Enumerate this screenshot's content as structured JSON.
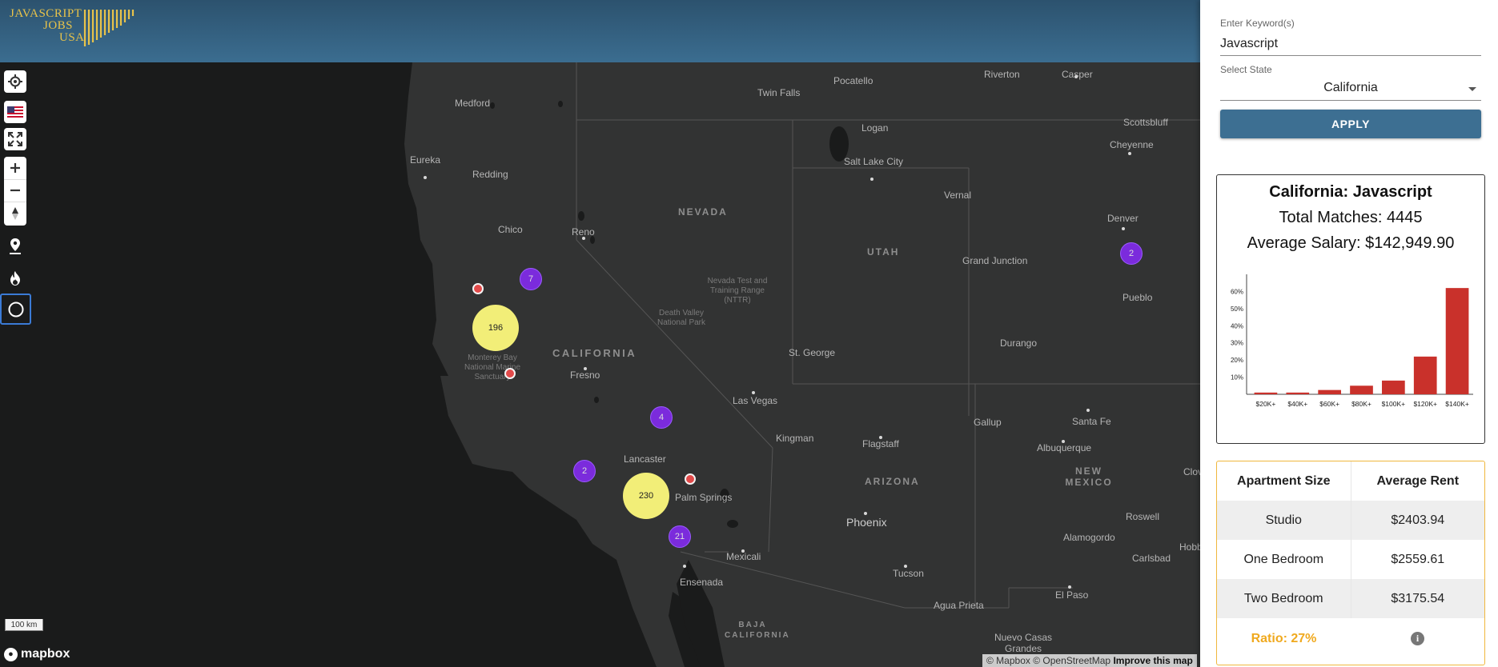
{
  "logo": {
    "line1": "JAVASCRIPT",
    "line2": "JOBS",
    "line3": "USA"
  },
  "map": {
    "places": [
      {
        "name": "Medford"
      },
      {
        "name": "Twin Falls"
      },
      {
        "name": "Pocatello"
      },
      {
        "name": "Riverton"
      },
      {
        "name": "Casper"
      },
      {
        "name": "Logan"
      },
      {
        "name": "Scottsbluff"
      },
      {
        "name": "Cheyenne"
      },
      {
        "name": "Eureka"
      },
      {
        "name": "Redding"
      },
      {
        "name": "Salt Lake City"
      },
      {
        "name": "Vernal"
      },
      {
        "name": "Chico"
      },
      {
        "name": "Reno"
      },
      {
        "name": "Denver"
      },
      {
        "name": "Grand Junction"
      },
      {
        "name": "Pueblo"
      },
      {
        "name": "Fresno"
      },
      {
        "name": "St. George"
      },
      {
        "name": "Durango"
      },
      {
        "name": "Las Vegas"
      },
      {
        "name": "Gallup"
      },
      {
        "name": "Santa Fe"
      },
      {
        "name": "Kingman"
      },
      {
        "name": "Flagstaff"
      },
      {
        "name": "Albuquerque"
      },
      {
        "name": "Lancaster"
      },
      {
        "name": "Palm Springs"
      },
      {
        "name": "Phoenix"
      },
      {
        "name": "Roswell"
      },
      {
        "name": "Alamogordo"
      },
      {
        "name": "Carlsbad"
      },
      {
        "name": "Mexicali"
      },
      {
        "name": "Tucson"
      },
      {
        "name": "Ensenada"
      },
      {
        "name": "Agua Prieta"
      },
      {
        "name": "El Paso"
      },
      {
        "name": "Nuevo Casas Grandes"
      },
      {
        "name": "Clovis"
      },
      {
        "name": "Hobb"
      }
    ],
    "regions": {
      "nevada": "NEVADA",
      "utah": "UTAH",
      "california": "CALIFORNIA",
      "arizona": "ARIZONA",
      "new_mexico": "NEW MEXICO",
      "baja": "BAJA CALIFORNIA"
    },
    "parks": {
      "nttr": "Nevada Test and Training Range (NTTR)",
      "death_valley": "Death Valley National Park",
      "monterey": "Monterey Bay National Marine Sanctuary"
    },
    "clusters": [
      {
        "label": "196",
        "color": "yellow"
      },
      {
        "label": "230",
        "color": "yellow"
      },
      {
        "label": "7",
        "color": "purple"
      },
      {
        "label": "4",
        "color": "purple"
      },
      {
        "label": "2",
        "color": "purple"
      },
      {
        "label": "21",
        "color": "purple"
      },
      {
        "label": "2",
        "color": "purple"
      }
    ],
    "scale": "100 km",
    "mapbox_logo": "mapbox",
    "attribution": {
      "mapbox": "© Mapbox",
      "osm": "© OpenStreetMap",
      "improve": "Improve this map"
    }
  },
  "controls": [
    {
      "name": "geolocate",
      "icon": "crosshair-icon"
    },
    {
      "name": "us-view",
      "icon": "us-flag-icon"
    },
    {
      "name": "fullscreen",
      "icon": "fullscreen-icon"
    },
    {
      "name": "zoom-in",
      "icon": "plus-icon"
    },
    {
      "name": "zoom-out",
      "icon": "minus-icon"
    },
    {
      "name": "compass",
      "icon": "compass-icon"
    },
    {
      "name": "markers",
      "icon": "map-pin-icon"
    },
    {
      "name": "heatmap",
      "icon": "flame-icon"
    },
    {
      "name": "clusters",
      "icon": "circle-icon"
    }
  ],
  "panel": {
    "keyword_label": "Enter Keyword(s)",
    "keyword_value": "Javascript",
    "state_label": "Select State",
    "state_value": "California",
    "apply_label": "APPLY",
    "title": "California: Javascript",
    "total_matches": "Total Matches: 4445",
    "avg_salary": "Average Salary: $142,949.90",
    "rent_table": {
      "headers": [
        "Apartment Size",
        "Average Rent"
      ],
      "rows": [
        [
          "Studio",
          "$2403.94"
        ],
        [
          "One Bedroom",
          "$2559.61"
        ],
        [
          "Two Bedroom",
          "$3175.54"
        ]
      ],
      "ratio": "Ratio: 27%"
    }
  },
  "colors": {
    "accent": "#3d6f92",
    "bar": "#c9312b",
    "cluster_yellow": "#f2ee78",
    "cluster_purple": "#7b2bdc",
    "pin_red": "#e24a4a",
    "ratio": "#f0a91e"
  },
  "chart_data": {
    "type": "bar",
    "categories": [
      "$20K+",
      "$40K+",
      "$60K+",
      "$80K+",
      "$100K+",
      "$120K+",
      "$140K+"
    ],
    "values": [
      1,
      1,
      2.5,
      5,
      8,
      22,
      62
    ],
    "yticks": [
      "10%",
      "20%",
      "30%",
      "40%",
      "50%",
      "60%"
    ],
    "ylim": [
      0,
      70
    ],
    "title": "",
    "xlabel": "",
    "ylabel": ""
  }
}
